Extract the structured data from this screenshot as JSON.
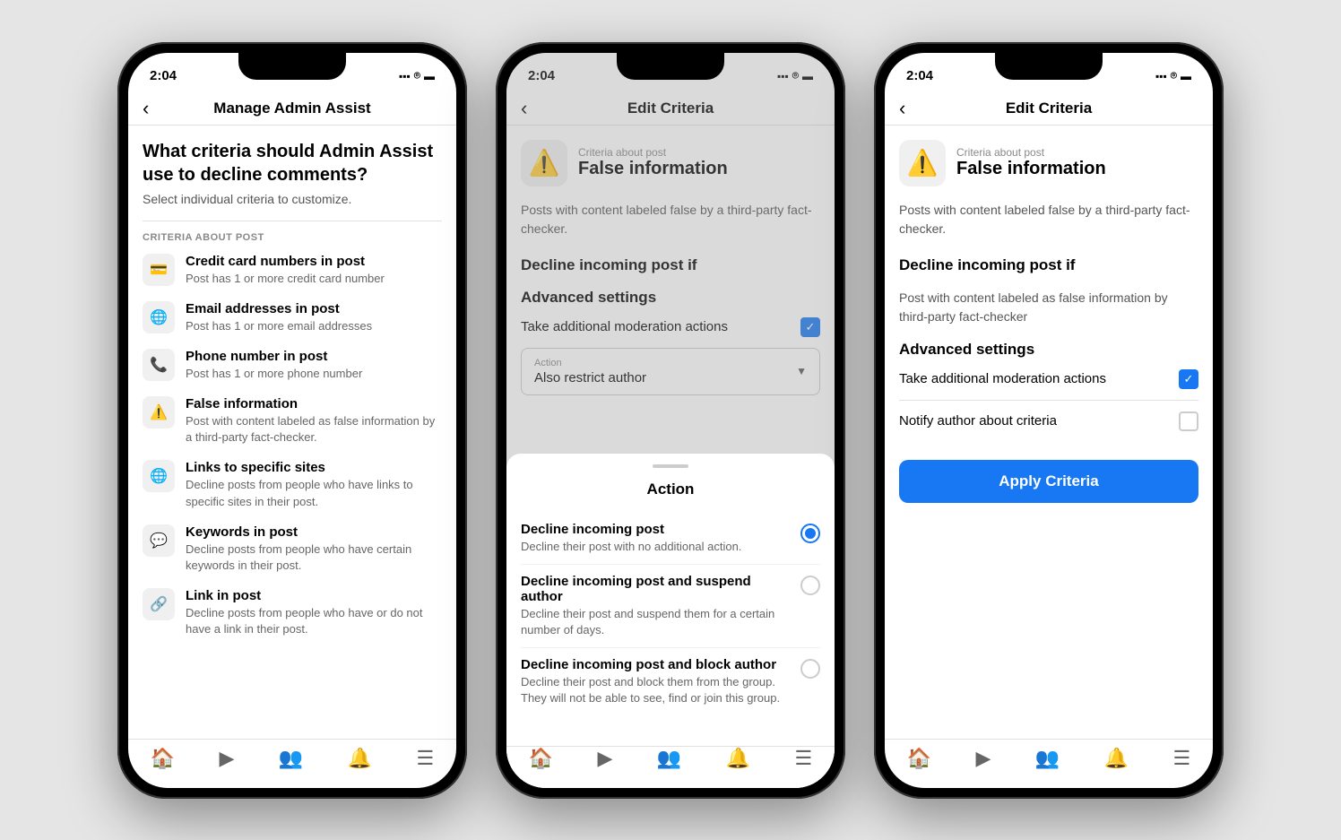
{
  "phones": [
    {
      "id": "phone1",
      "status": {
        "time": "2:04",
        "signal": "▪▪▪",
        "wifi": "WiFi",
        "battery": "🔋"
      },
      "nav": {
        "title": "Manage Admin Assist",
        "back_label": "‹"
      },
      "screen1": {
        "heading": "What criteria should Admin Assist use to decline comments?",
        "subheading": "Select individual criteria to customize.",
        "section_label": "CRITERIA ABOUT POST",
        "items": [
          {
            "icon": "💳",
            "name": "Credit card numbers in post",
            "desc": "Post has 1 or more credit card number"
          },
          {
            "icon": "🌐",
            "name": "Email addresses in post",
            "desc": "Post has 1 or more email addresses"
          },
          {
            "icon": "📞",
            "name": "Phone number in post",
            "desc": "Post has 1 or more phone number"
          },
          {
            "icon": "⚠",
            "name": "False information",
            "desc": "Post with content labeled as false information by a third-party fact-checker."
          },
          {
            "icon": "🌐",
            "name": "Links to specific sites",
            "desc": "Decline posts from people who have links to specific sites in their post."
          },
          {
            "icon": "💬",
            "name": "Keywords in post",
            "desc": "Decline posts from people who have certain keywords in their post."
          },
          {
            "icon": "🔗",
            "name": "Link in post",
            "desc": "Decline posts from people who have or do not have a link in their post."
          }
        ]
      },
      "bottom_nav": [
        "🏠",
        "▶",
        "👥",
        "🔔",
        "☰"
      ]
    },
    {
      "id": "phone2",
      "status": {
        "time": "2:04"
      },
      "nav": {
        "title": "Edit Criteria",
        "back_label": "‹"
      },
      "screen2": {
        "criteria_label": "Criteria about post",
        "criteria_title": "False information",
        "body_text": "Posts with content labeled false by a third-party fact-checker.",
        "decline_title": "Decline incoming post if",
        "advanced_title": "Advanced settings",
        "checkbox_label": "Take additional moderation actions",
        "action_label": "Action",
        "action_value": "Also restrict author",
        "sheet": {
          "title": "Action",
          "options": [
            {
              "name": "Decline incoming post",
              "desc": "Decline their post with no additional action.",
              "selected": true
            },
            {
              "name": "Decline incoming post and suspend author",
              "desc": "Decline their post and suspend them for a certain number of days.",
              "selected": false
            },
            {
              "name": "Decline incoming post and block author",
              "desc": "Decline their post and block them from the group. They will not be able to see, find or join this group.",
              "selected": false
            }
          ]
        }
      },
      "bottom_nav": [
        "🏠",
        "▶",
        "👥",
        "🔔",
        "☰"
      ]
    },
    {
      "id": "phone3",
      "status": {
        "time": "2:04"
      },
      "nav": {
        "title": "Edit Criteria",
        "back_label": "‹"
      },
      "screen3": {
        "criteria_label": "Criteria about post",
        "criteria_title": "False information",
        "body_text": "Posts with content labeled false by a third-party fact-checker.",
        "decline_title": "Decline incoming post if",
        "decline_body": "Post with content labeled as false information by third-party fact-checker",
        "advanced_title": "Advanced settings",
        "checkbox1_label": "Take additional moderation actions",
        "checkbox1_checked": true,
        "checkbox2_label": "Notify author about criteria",
        "checkbox2_checked": false,
        "apply_label": "Apply Criteria"
      },
      "bottom_nav": [
        "🏠",
        "▶",
        "👥",
        "🔔",
        "☰"
      ]
    }
  ]
}
